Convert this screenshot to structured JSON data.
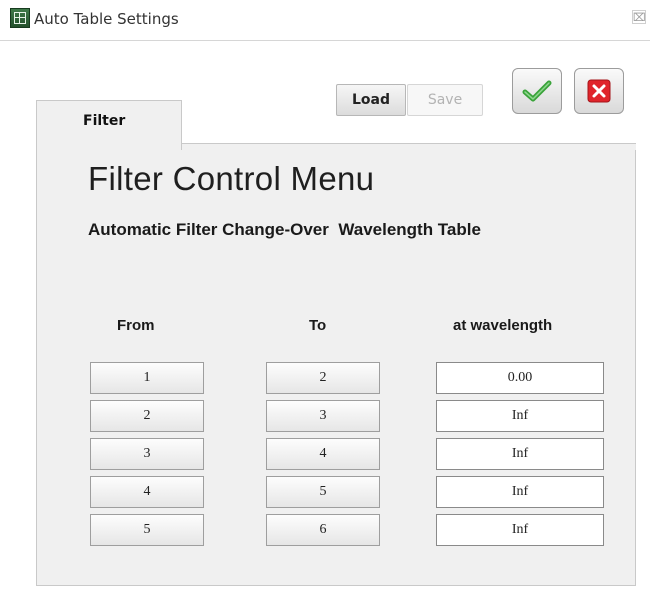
{
  "window": {
    "title": "Auto Table Settings",
    "close_glyph": "⌧"
  },
  "toolbar": {
    "load_label": "Load",
    "save_label": "Save"
  },
  "icons": {
    "app": "auto-table-app-icon",
    "ok": "green-checkmark-icon",
    "cancel": "red-x-icon"
  },
  "colors": {
    "ok_check": "#3aa33a",
    "cancel_red": "#e0242b"
  },
  "tab": {
    "label": "Filter"
  },
  "panel": {
    "title": "Filter Control Menu",
    "subtitle": "Automatic Filter Change-Over  Wavelength Table"
  },
  "table": {
    "headers": {
      "from": "From",
      "to": "To",
      "wavelength": "at wavelength"
    },
    "rows": [
      {
        "from": "1",
        "to": "2",
        "wavelength": "0.00"
      },
      {
        "from": "2",
        "to": "3",
        "wavelength": "Inf"
      },
      {
        "from": "3",
        "to": "4",
        "wavelength": "Inf"
      },
      {
        "from": "4",
        "to": "5",
        "wavelength": "Inf"
      },
      {
        "from": "5",
        "to": "6",
        "wavelength": "Inf"
      }
    ]
  }
}
